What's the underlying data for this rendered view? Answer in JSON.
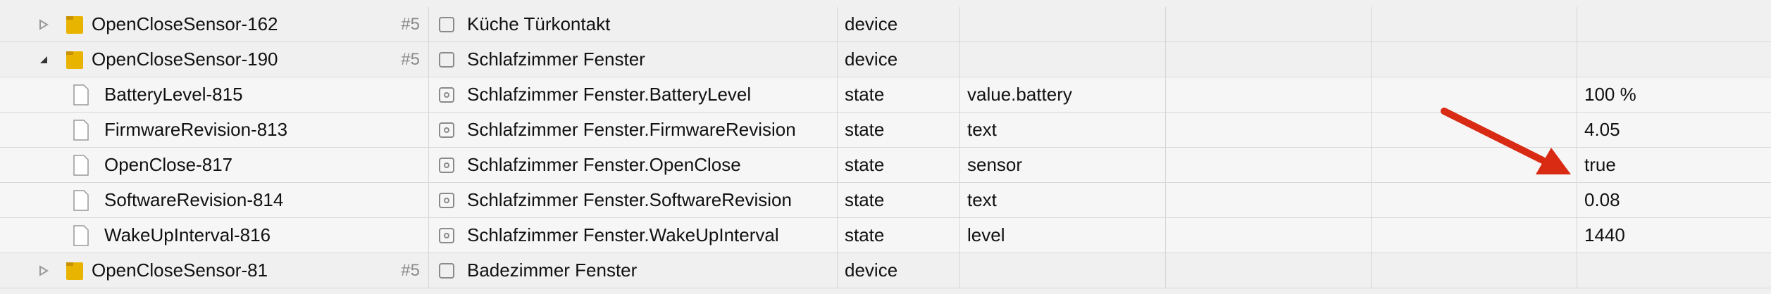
{
  "rows": [
    {
      "name": "OpenCloseSensor-162",
      "num": "#5",
      "title": "Küche Türkontakt",
      "type": "device",
      "role": "",
      "value": ""
    },
    {
      "name": "OpenCloseSensor-190",
      "num": "#5",
      "title": "Schlafzimmer Fenster",
      "type": "device",
      "role": "",
      "value": ""
    },
    {
      "name": "BatteryLevel-815",
      "num": "",
      "title": "Schlafzimmer Fenster.BatteryLevel",
      "type": "state",
      "role": "value.battery",
      "value": "100 %"
    },
    {
      "name": "FirmwareRevision-813",
      "num": "",
      "title": "Schlafzimmer Fenster.FirmwareRevision",
      "type": "state",
      "role": "text",
      "value": "4.05"
    },
    {
      "name": "OpenClose-817",
      "num": "",
      "title": "Schlafzimmer Fenster.OpenClose",
      "type": "state",
      "role": "sensor",
      "value": "true"
    },
    {
      "name": "SoftwareRevision-814",
      "num": "",
      "title": "Schlafzimmer Fenster.SoftwareRevision",
      "type": "state",
      "role": "text",
      "value": "0.08"
    },
    {
      "name": "WakeUpInterval-816",
      "num": "",
      "title": "Schlafzimmer Fenster.WakeUpInterval",
      "type": "state",
      "role": "level",
      "value": "1440"
    },
    {
      "name": "OpenCloseSensor-81",
      "num": "#5",
      "title": "Badezimmer Fenster",
      "type": "device",
      "role": "",
      "value": ""
    }
  ],
  "colors": {
    "arrow": "#d92b14",
    "folder": "#e9b400",
    "accent_row": "#ffffff"
  }
}
